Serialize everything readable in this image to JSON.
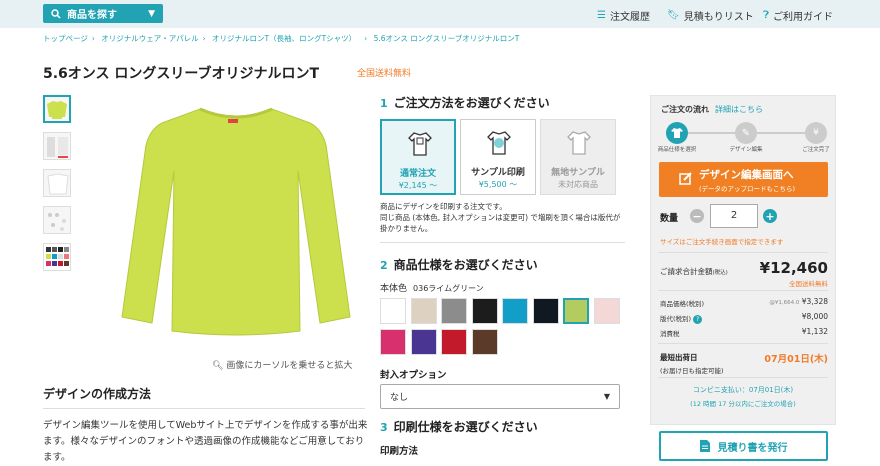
{
  "topbar": {
    "search_label": "商品を探す",
    "links": [
      "注文履歴",
      "見積もりリスト",
      "ご利用ガイド"
    ]
  },
  "breadcrumb": [
    "トップページ",
    "オリジナルウェア・アパレル",
    "オリジナルロンT（長袖、ロングTシャツ）",
    "5.6オンス ロングスリーブオリジナルロンT"
  ],
  "product": {
    "title": "5.6オンス ロングスリーブオリジナルロンT",
    "free_shipping": "全国送料無料",
    "zoom_hint": "画像にカーソルを乗せると拡大",
    "shirt_color": "#cbe04c"
  },
  "design": {
    "heading": "デザインの作成方法",
    "desc": "デザイン編集ツールを使用してWebサイト上でデザインを作成する事が出来ます。様々なデザインのフォントや透過画像の作成機能などご用意しております。"
  },
  "order_method": {
    "num": "1",
    "heading": "ご注文方法をお選びください",
    "options": [
      {
        "label": "通常注文",
        "price": "¥2,145 ～"
      },
      {
        "label": "サンプル印刷",
        "price": "¥5,500 ～"
      },
      {
        "label": "無地サンプル",
        "price": "未対応商品"
      }
    ],
    "note": "商品にデザインを印刷する注文です。\n同じ商品 (本体色, 封入オプションは変更可) で増刷を頂く場合は版代が掛かりません。"
  },
  "spec": {
    "num": "2",
    "heading": "商品仕様をお選びください",
    "body_color_label": "本体色",
    "body_color_name": "036ライムグリーン",
    "swatches": [
      "#ffffff",
      "#ddd2c2",
      "#8c8c8c",
      "#1c1c1c",
      "#119ec9",
      "#101822",
      "#b2cc60",
      "#f3d8d7",
      "#d8306e",
      "#4a3592",
      "#c21a2b",
      "#5c3a2a"
    ],
    "insert_label": "封入オプション",
    "insert_value": "なし"
  },
  "print_spec": {
    "num": "3",
    "heading": "印刷仕様をお選びください",
    "method_label": "印刷方法"
  },
  "panel": {
    "flow_heading": "ご注文の流れ",
    "flow_link": "詳細はこちら",
    "steps": [
      "商品仕様を選択",
      "デザイン編集",
      "ご注文完了"
    ],
    "cta_main": "デザイン編集画面へ",
    "cta_sub": "(データのアップロードもこちら)",
    "qty_label": "数量",
    "qty_value": "2",
    "qty_note": "サイズはご注文手続き画面で指定できます",
    "total_label": "ご請求合計金額",
    "total_tax": "(税込)",
    "total_value": "¥12,460",
    "total_free": "全国送料無料",
    "rows": [
      {
        "label": "商品価格(税別)",
        "sub": "@¥1,664.0",
        "value": "¥3,328"
      },
      {
        "label": "版代(税別)",
        "sub": "",
        "value": "¥8,000"
      },
      {
        "label": "消費税",
        "sub": "",
        "value": "¥1,132"
      }
    ],
    "ship_label": "最短出荷日",
    "ship_sub": "(お届け日も指定可能)",
    "ship_value": "07月01日(木)",
    "conv_line1": "コンビニ支払い：07月01日(木)",
    "conv_line2": "(12 時間 17 分以内にご注文の場合)",
    "quote_button": "見積り書を発行"
  },
  "colors": {
    "accent": "#21a3b3",
    "orange": "#f08023"
  }
}
